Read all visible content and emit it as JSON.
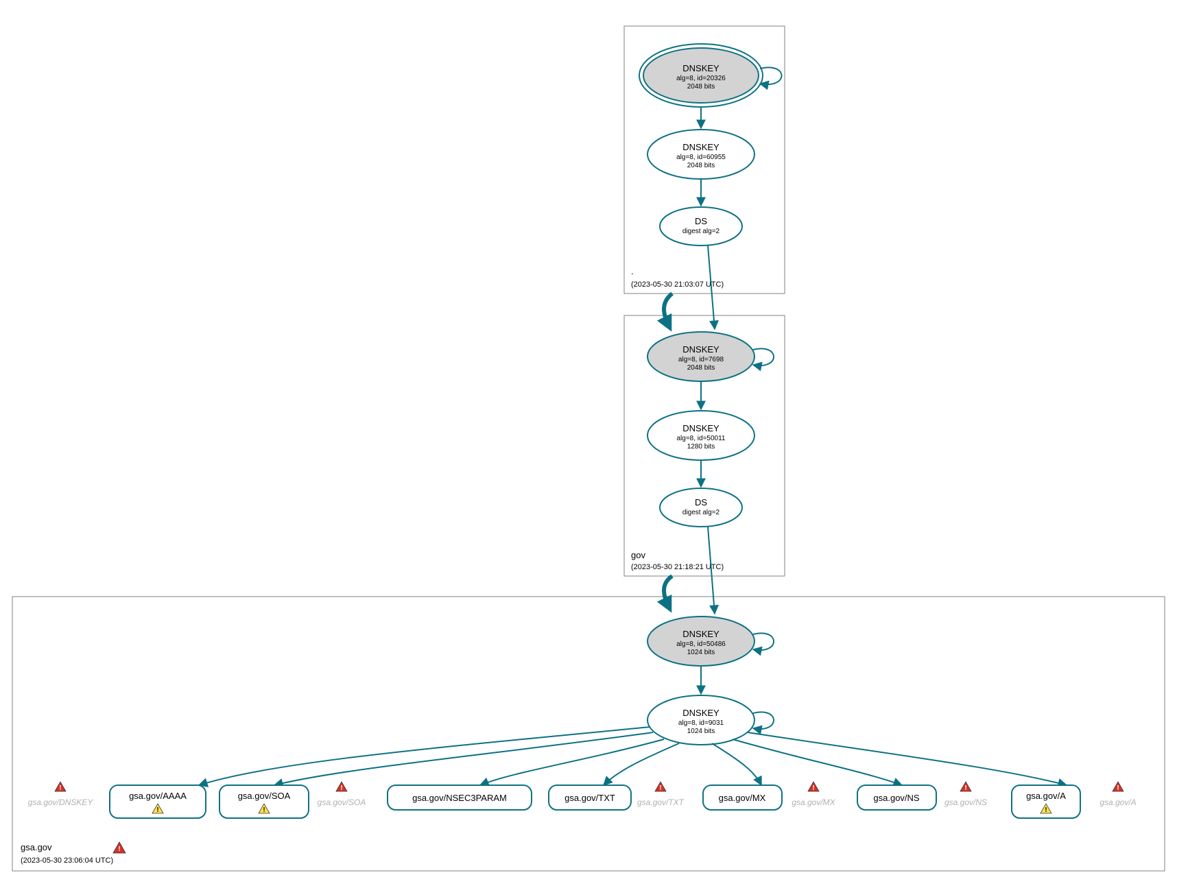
{
  "colors": {
    "accent": "#0d7184",
    "node_grey": "#d3d3d3",
    "warn_yellow": "#ffe34d",
    "warn_red": "#d93024"
  },
  "zones": {
    "root": {
      "label": ".",
      "timestamp": "(2023-05-30 21:03:07 UTC)"
    },
    "gov": {
      "label": "gov",
      "timestamp": "(2023-05-30 21:18:21 UTC)"
    },
    "gsa": {
      "label": "gsa.gov",
      "timestamp": "(2023-05-30 23:06:04 UTC)"
    }
  },
  "nodes": {
    "root_ksk": {
      "title": "DNSKEY",
      "line1": "alg=8, id=20326",
      "line2": "2048 bits"
    },
    "root_zsk": {
      "title": "DNSKEY",
      "line1": "alg=8, id=60955",
      "line2": "2048 bits"
    },
    "root_ds": {
      "title": "DS",
      "line1": "digest alg=2",
      "line2": ""
    },
    "gov_ksk": {
      "title": "DNSKEY",
      "line1": "alg=8, id=7698",
      "line2": "2048 bits"
    },
    "gov_zsk": {
      "title": "DNSKEY",
      "line1": "alg=8, id=50011",
      "line2": "1280 bits"
    },
    "gov_ds": {
      "title": "DS",
      "line1": "digest alg=2",
      "line2": ""
    },
    "gsa_ksk": {
      "title": "DNSKEY",
      "line1": "alg=8, id=50486",
      "line2": "1024 bits"
    },
    "gsa_zsk": {
      "title": "DNSKEY",
      "line1": "alg=8, id=9031",
      "line2": "1024 bits"
    }
  },
  "rr": {
    "aaaa": "gsa.gov/AAAA",
    "soa": "gsa.gov/SOA",
    "nsec3param": "gsa.gov/NSEC3PARAM",
    "txt": "gsa.gov/TXT",
    "mx": "gsa.gov/MX",
    "ns": "gsa.gov/NS",
    "a": "gsa.gov/A"
  },
  "ghosts": {
    "dnskey": "gsa.gov/DNSKEY",
    "soa": "gsa.gov/SOA",
    "txt": "gsa.gov/TXT",
    "mx": "gsa.gov/MX",
    "ns": "gsa.gov/NS",
    "a": "gsa.gov/A"
  }
}
